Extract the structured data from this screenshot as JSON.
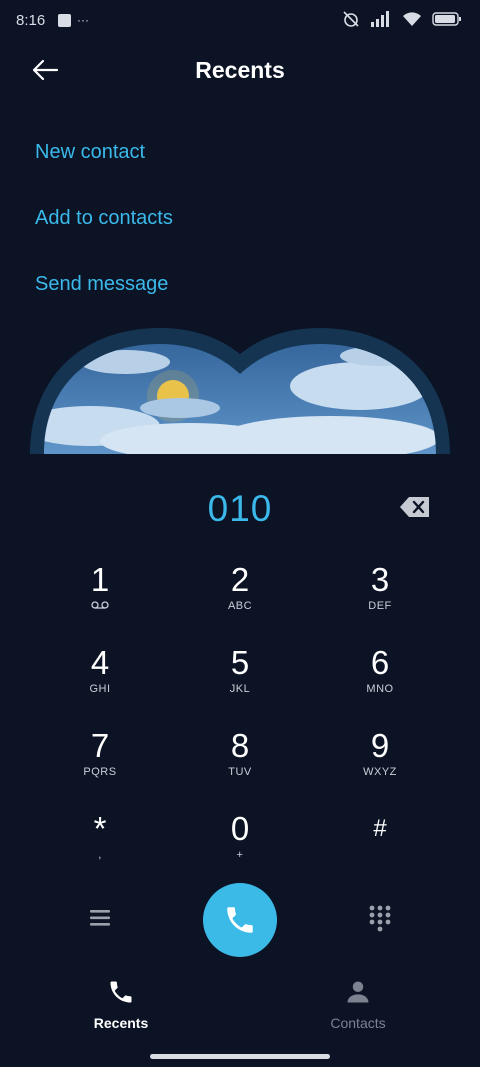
{
  "status_bar": {
    "time": "8:16",
    "notification_extra": "···",
    "icons": [
      "alarm-off-icon",
      "signal-icon",
      "wifi-icon",
      "battery-icon"
    ]
  },
  "header": {
    "title": "Recents",
    "back_icon": "back-arrow-icon"
  },
  "actions": [
    {
      "label": "New contact"
    },
    {
      "label": "Add to contacts"
    },
    {
      "label": "Send message"
    }
  ],
  "dialer": {
    "number": "010",
    "backspace_icon": "backspace-icon"
  },
  "keypad": [
    {
      "digit": "1",
      "letters": ""
    },
    {
      "digit": "2",
      "letters": "ABC"
    },
    {
      "digit": "3",
      "letters": "DEF"
    },
    {
      "digit": "4",
      "letters": "GHI"
    },
    {
      "digit": "5",
      "letters": "JKL"
    },
    {
      "digit": "6",
      "letters": "MNO"
    },
    {
      "digit": "7",
      "letters": "PQRS"
    },
    {
      "digit": "8",
      "letters": "TUV"
    },
    {
      "digit": "9",
      "letters": "WXYZ"
    },
    {
      "digit": "*",
      "letters": ","
    },
    {
      "digit": "0",
      "letters": "+"
    },
    {
      "digit": "#",
      "letters": ""
    }
  ],
  "bottom_controls": {
    "menu_icon": "menu-icon",
    "call_icon": "phone-icon",
    "dialpad_icon": "dialpad-icon"
  },
  "nav": {
    "recents_label": "Recents",
    "contacts_label": "Contacts",
    "active": "recents"
  },
  "colors": {
    "background": "#0b1325",
    "accent": "#3bb9ea",
    "inactive": "#7b8391"
  }
}
